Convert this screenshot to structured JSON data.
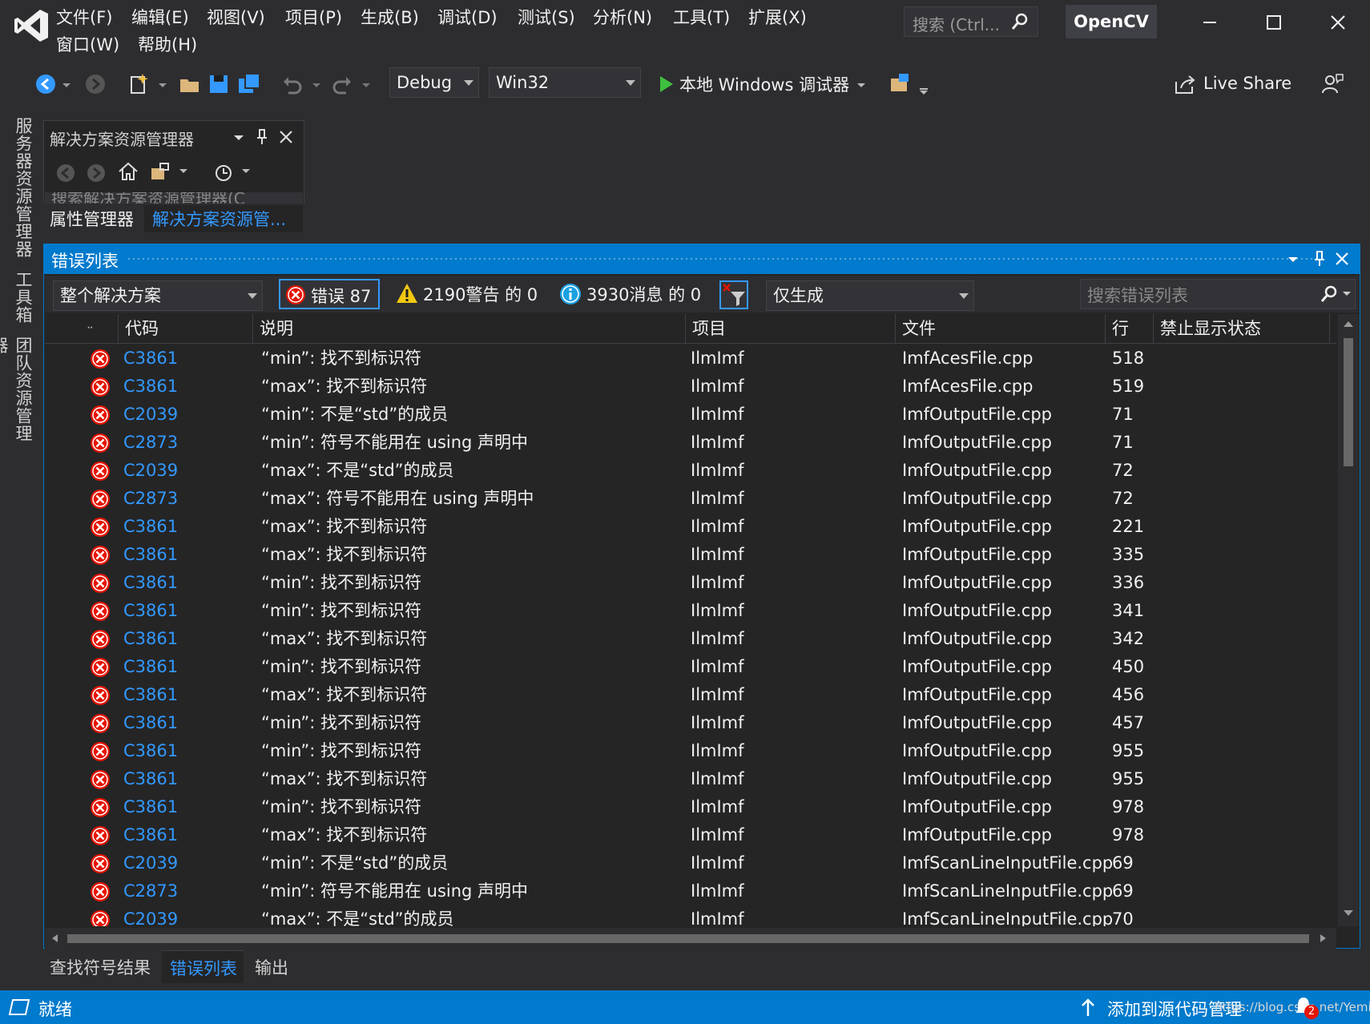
{
  "window": {
    "menu": [
      "文件(F)",
      "编辑(E)",
      "视图(V)",
      "项目(P)",
      "生成(B)",
      "调试(D)",
      "测试(S)",
      "分析(N)",
      "工具(T)",
      "扩展(X)",
      "窗口(W)",
      "帮助(H)"
    ],
    "search_placeholder": "搜索 (Ctrl...",
    "solution_name": "OpenCV"
  },
  "toolbar": {
    "config": "Debug",
    "platform": "Win32",
    "run_label": "本地 Windows 调试器",
    "live_share": "Live Share"
  },
  "side_tabs": [
    "服务器资源管理器",
    "工具箱",
    "团队资源管理器"
  ],
  "solution_explorer": {
    "title": "解决方案资源管理器",
    "search_placeholder": "搜索解决方案资源管理器(C",
    "tabs": [
      "属性管理器",
      "解决方案资源管..."
    ]
  },
  "error_list": {
    "title": "错误列表",
    "scope": "整个解决方案",
    "errors_btn": "错误 87",
    "warnings_btn": "2190警告 的 0",
    "messages_btn": "3930消息 的 0",
    "build_filter": "仅生成",
    "search_placeholder": "搜索错误列表",
    "columns": [
      "代码",
      "说明",
      "项目",
      "文件",
      "行",
      "禁止显示状态"
    ],
    "rows": [
      {
        "code": "C3861",
        "desc": "“min”: 找不到标识符",
        "project": "IlmImf",
        "file": "ImfAcesFile.cpp",
        "line": "518"
      },
      {
        "code": "C3861",
        "desc": "“max”: 找不到标识符",
        "project": "IlmImf",
        "file": "ImfAcesFile.cpp",
        "line": "519"
      },
      {
        "code": "C2039",
        "desc": "“min”: 不是“std”的成员",
        "project": "IlmImf",
        "file": "ImfOutputFile.cpp",
        "line": "71"
      },
      {
        "code": "C2873",
        "desc": "“min”: 符号不能用在 using 声明中",
        "project": "IlmImf",
        "file": "ImfOutputFile.cpp",
        "line": "71"
      },
      {
        "code": "C2039",
        "desc": "“max”: 不是“std”的成员",
        "project": "IlmImf",
        "file": "ImfOutputFile.cpp",
        "line": "72"
      },
      {
        "code": "C2873",
        "desc": "“max”: 符号不能用在 using 声明中",
        "project": "IlmImf",
        "file": "ImfOutputFile.cpp",
        "line": "72"
      },
      {
        "code": "C3861",
        "desc": "“max”: 找不到标识符",
        "project": "IlmImf",
        "file": "ImfOutputFile.cpp",
        "line": "221"
      },
      {
        "code": "C3861",
        "desc": "“max”: 找不到标识符",
        "project": "IlmImf",
        "file": "ImfOutputFile.cpp",
        "line": "335"
      },
      {
        "code": "C3861",
        "desc": "“min”: 找不到标识符",
        "project": "IlmImf",
        "file": "ImfOutputFile.cpp",
        "line": "336"
      },
      {
        "code": "C3861",
        "desc": "“min”: 找不到标识符",
        "project": "IlmImf",
        "file": "ImfOutputFile.cpp",
        "line": "341"
      },
      {
        "code": "C3861",
        "desc": "“max”: 找不到标识符",
        "project": "IlmImf",
        "file": "ImfOutputFile.cpp",
        "line": "342"
      },
      {
        "code": "C3861",
        "desc": "“min”: 找不到标识符",
        "project": "IlmImf",
        "file": "ImfOutputFile.cpp",
        "line": "450"
      },
      {
        "code": "C3861",
        "desc": "“max”: 找不到标识符",
        "project": "IlmImf",
        "file": "ImfOutputFile.cpp",
        "line": "456"
      },
      {
        "code": "C3861",
        "desc": "“min”: 找不到标识符",
        "project": "IlmImf",
        "file": "ImfOutputFile.cpp",
        "line": "457"
      },
      {
        "code": "C3861",
        "desc": "“min”: 找不到标识符",
        "project": "IlmImf",
        "file": "ImfOutputFile.cpp",
        "line": "955"
      },
      {
        "code": "C3861",
        "desc": "“max”: 找不到标识符",
        "project": "IlmImf",
        "file": "ImfOutputFile.cpp",
        "line": "955"
      },
      {
        "code": "C3861",
        "desc": "“min”: 找不到标识符",
        "project": "IlmImf",
        "file": "ImfOutputFile.cpp",
        "line": "978"
      },
      {
        "code": "C3861",
        "desc": "“max”: 找不到标识符",
        "project": "IlmImf",
        "file": "ImfOutputFile.cpp",
        "line": "978"
      },
      {
        "code": "C2039",
        "desc": "“min”: 不是“std”的成员",
        "project": "IlmImf",
        "file": "ImfScanLineInputFile.cpp",
        "line": "69"
      },
      {
        "code": "C2873",
        "desc": "“min”: 符号不能用在 using 声明中",
        "project": "IlmImf",
        "file": "ImfScanLineInputFile.cpp",
        "line": "69"
      },
      {
        "code": "C2039",
        "desc": "“max”: 不是“std”的成员",
        "project": "IlmImf",
        "file": "ImfScanLineInputFile.cpp",
        "line": "70"
      }
    ]
  },
  "bottom_tabs": [
    "查找符号结果",
    "错误列表",
    "输出"
  ],
  "status": {
    "ready": "就绪",
    "source_control": "添加到源代码管理",
    "watermark": "https://blog.csdn.net/Yemiekai",
    "notification_count": "2"
  },
  "colors": {
    "accent": "#007acc",
    "background": "#2d2d30",
    "panel": "#252526",
    "error_red": "#e51400",
    "code_link": "#3399ff"
  }
}
